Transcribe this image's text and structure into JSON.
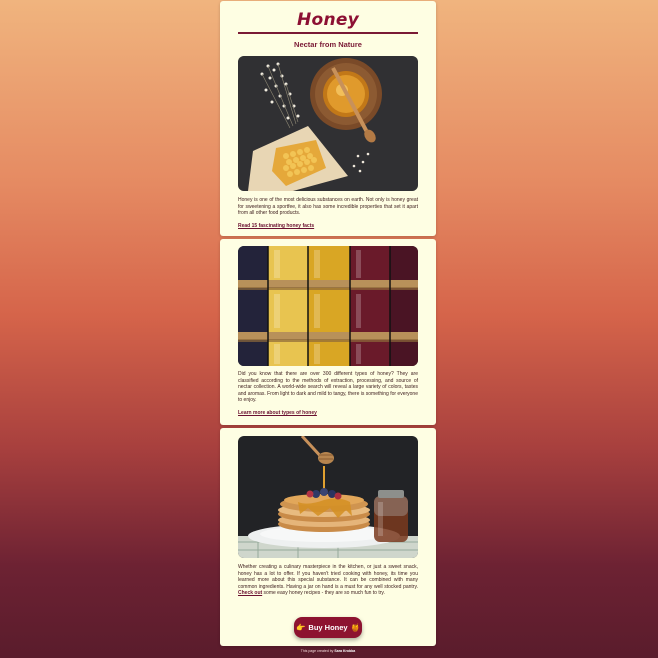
{
  "header": {
    "title": "Honey",
    "subtitle": "Nectar from Nature"
  },
  "cards": [
    {
      "image": "honeycomb-and-honey-jar-photo",
      "text": "Honey is one of the most delicious substances on earth. Not only is honey great for sweetening a sportfee, it also has some incredible properties that set it apart from all other food products.",
      "link": "Read 15 fascinating honey facts"
    },
    {
      "image": "jars-of-honey-photo",
      "text": "Did you know that there are over 300 different types of honey? They are classified according to the methods of extraction, processing, and source of nectar collection. A world-wide search will reveal a large variety of colors, tastes and aromas. From light to dark and mild to tangy, there is something for everyone to enjoy.",
      "link": "Learn more about types of honey"
    },
    {
      "image": "pancakes-with-honey-photo",
      "text_before": "Whether creating a culinary masterpiece in the kitchen, or just a sweet snack, honey has a lot to offer. If you haven't tried cooking with honey, its time you learned more about this special substance. It can be combined with many common ingredients. Having a jar on hand is a must for any well stocked pantry.",
      "link": "Check out",
      "text_after": " some easy honey recipes - they are so much fun to try."
    }
  ],
  "buy_button": {
    "icon_left": "👉",
    "label": "Buy Honey",
    "icon_right": "🍯"
  },
  "footer": {
    "text": "This page created by ",
    "author": "Sara Krobba"
  }
}
